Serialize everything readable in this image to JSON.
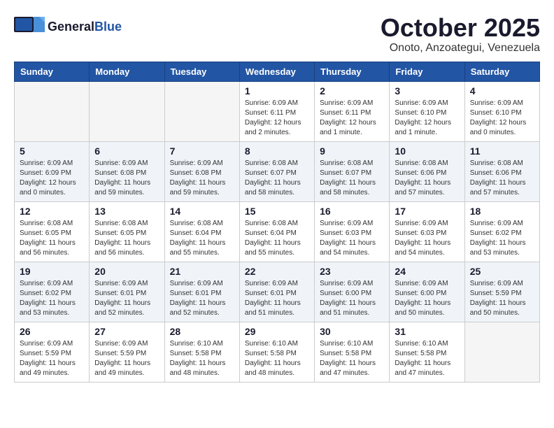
{
  "header": {
    "logo_general": "General",
    "logo_blue": "Blue",
    "month": "October 2025",
    "location": "Onoto, Anzoategui, Venezuela"
  },
  "days_of_week": [
    "Sunday",
    "Monday",
    "Tuesday",
    "Wednesday",
    "Thursday",
    "Friday",
    "Saturday"
  ],
  "weeks": [
    [
      {
        "day": "",
        "empty": true
      },
      {
        "day": "",
        "empty": true
      },
      {
        "day": "",
        "empty": true
      },
      {
        "day": "1",
        "line1": "Sunrise: 6:09 AM",
        "line2": "Sunset: 6:11 PM",
        "line3": "Daylight: 12 hours",
        "line4": "and 2 minutes."
      },
      {
        "day": "2",
        "line1": "Sunrise: 6:09 AM",
        "line2": "Sunset: 6:11 PM",
        "line3": "Daylight: 12 hours",
        "line4": "and 1 minute."
      },
      {
        "day": "3",
        "line1": "Sunrise: 6:09 AM",
        "line2": "Sunset: 6:10 PM",
        "line3": "Daylight: 12 hours",
        "line4": "and 1 minute."
      },
      {
        "day": "4",
        "line1": "Sunrise: 6:09 AM",
        "line2": "Sunset: 6:10 PM",
        "line3": "Daylight: 12 hours",
        "line4": "and 0 minutes."
      }
    ],
    [
      {
        "day": "5",
        "line1": "Sunrise: 6:09 AM",
        "line2": "Sunset: 6:09 PM",
        "line3": "Daylight: 12 hours",
        "line4": "and 0 minutes."
      },
      {
        "day": "6",
        "line1": "Sunrise: 6:09 AM",
        "line2": "Sunset: 6:08 PM",
        "line3": "Daylight: 11 hours",
        "line4": "and 59 minutes."
      },
      {
        "day": "7",
        "line1": "Sunrise: 6:09 AM",
        "line2": "Sunset: 6:08 PM",
        "line3": "Daylight: 11 hours",
        "line4": "and 59 minutes."
      },
      {
        "day": "8",
        "line1": "Sunrise: 6:08 AM",
        "line2": "Sunset: 6:07 PM",
        "line3": "Daylight: 11 hours",
        "line4": "and 58 minutes."
      },
      {
        "day": "9",
        "line1": "Sunrise: 6:08 AM",
        "line2": "Sunset: 6:07 PM",
        "line3": "Daylight: 11 hours",
        "line4": "and 58 minutes."
      },
      {
        "day": "10",
        "line1": "Sunrise: 6:08 AM",
        "line2": "Sunset: 6:06 PM",
        "line3": "Daylight: 11 hours",
        "line4": "and 57 minutes."
      },
      {
        "day": "11",
        "line1": "Sunrise: 6:08 AM",
        "line2": "Sunset: 6:06 PM",
        "line3": "Daylight: 11 hours",
        "line4": "and 57 minutes."
      }
    ],
    [
      {
        "day": "12",
        "line1": "Sunrise: 6:08 AM",
        "line2": "Sunset: 6:05 PM",
        "line3": "Daylight: 11 hours",
        "line4": "and 56 minutes."
      },
      {
        "day": "13",
        "line1": "Sunrise: 6:08 AM",
        "line2": "Sunset: 6:05 PM",
        "line3": "Daylight: 11 hours",
        "line4": "and 56 minutes."
      },
      {
        "day": "14",
        "line1": "Sunrise: 6:08 AM",
        "line2": "Sunset: 6:04 PM",
        "line3": "Daylight: 11 hours",
        "line4": "and 55 minutes."
      },
      {
        "day": "15",
        "line1": "Sunrise: 6:08 AM",
        "line2": "Sunset: 6:04 PM",
        "line3": "Daylight: 11 hours",
        "line4": "and 55 minutes."
      },
      {
        "day": "16",
        "line1": "Sunrise: 6:09 AM",
        "line2": "Sunset: 6:03 PM",
        "line3": "Daylight: 11 hours",
        "line4": "and 54 minutes."
      },
      {
        "day": "17",
        "line1": "Sunrise: 6:09 AM",
        "line2": "Sunset: 6:03 PM",
        "line3": "Daylight: 11 hours",
        "line4": "and 54 minutes."
      },
      {
        "day": "18",
        "line1": "Sunrise: 6:09 AM",
        "line2": "Sunset: 6:02 PM",
        "line3": "Daylight: 11 hours",
        "line4": "and 53 minutes."
      }
    ],
    [
      {
        "day": "19",
        "line1": "Sunrise: 6:09 AM",
        "line2": "Sunset: 6:02 PM",
        "line3": "Daylight: 11 hours",
        "line4": "and 53 minutes."
      },
      {
        "day": "20",
        "line1": "Sunrise: 6:09 AM",
        "line2": "Sunset: 6:01 PM",
        "line3": "Daylight: 11 hours",
        "line4": "and 52 minutes."
      },
      {
        "day": "21",
        "line1": "Sunrise: 6:09 AM",
        "line2": "Sunset: 6:01 PM",
        "line3": "Daylight: 11 hours",
        "line4": "and 52 minutes."
      },
      {
        "day": "22",
        "line1": "Sunrise: 6:09 AM",
        "line2": "Sunset: 6:01 PM",
        "line3": "Daylight: 11 hours",
        "line4": "and 51 minutes."
      },
      {
        "day": "23",
        "line1": "Sunrise: 6:09 AM",
        "line2": "Sunset: 6:00 PM",
        "line3": "Daylight: 11 hours",
        "line4": "and 51 minutes."
      },
      {
        "day": "24",
        "line1": "Sunrise: 6:09 AM",
        "line2": "Sunset: 6:00 PM",
        "line3": "Daylight: 11 hours",
        "line4": "and 50 minutes."
      },
      {
        "day": "25",
        "line1": "Sunrise: 6:09 AM",
        "line2": "Sunset: 5:59 PM",
        "line3": "Daylight: 11 hours",
        "line4": "and 50 minutes."
      }
    ],
    [
      {
        "day": "26",
        "line1": "Sunrise: 6:09 AM",
        "line2": "Sunset: 5:59 PM",
        "line3": "Daylight: 11 hours",
        "line4": "and 49 minutes."
      },
      {
        "day": "27",
        "line1": "Sunrise: 6:09 AM",
        "line2": "Sunset: 5:59 PM",
        "line3": "Daylight: 11 hours",
        "line4": "and 49 minutes."
      },
      {
        "day": "28",
        "line1": "Sunrise: 6:10 AM",
        "line2": "Sunset: 5:58 PM",
        "line3": "Daylight: 11 hours",
        "line4": "and 48 minutes."
      },
      {
        "day": "29",
        "line1": "Sunrise: 6:10 AM",
        "line2": "Sunset: 5:58 PM",
        "line3": "Daylight: 11 hours",
        "line4": "and 48 minutes."
      },
      {
        "day": "30",
        "line1": "Sunrise: 6:10 AM",
        "line2": "Sunset: 5:58 PM",
        "line3": "Daylight: 11 hours",
        "line4": "and 47 minutes."
      },
      {
        "day": "31",
        "line1": "Sunrise: 6:10 AM",
        "line2": "Sunset: 5:58 PM",
        "line3": "Daylight: 11 hours",
        "line4": "and 47 minutes."
      },
      {
        "day": "",
        "empty": true
      }
    ]
  ]
}
